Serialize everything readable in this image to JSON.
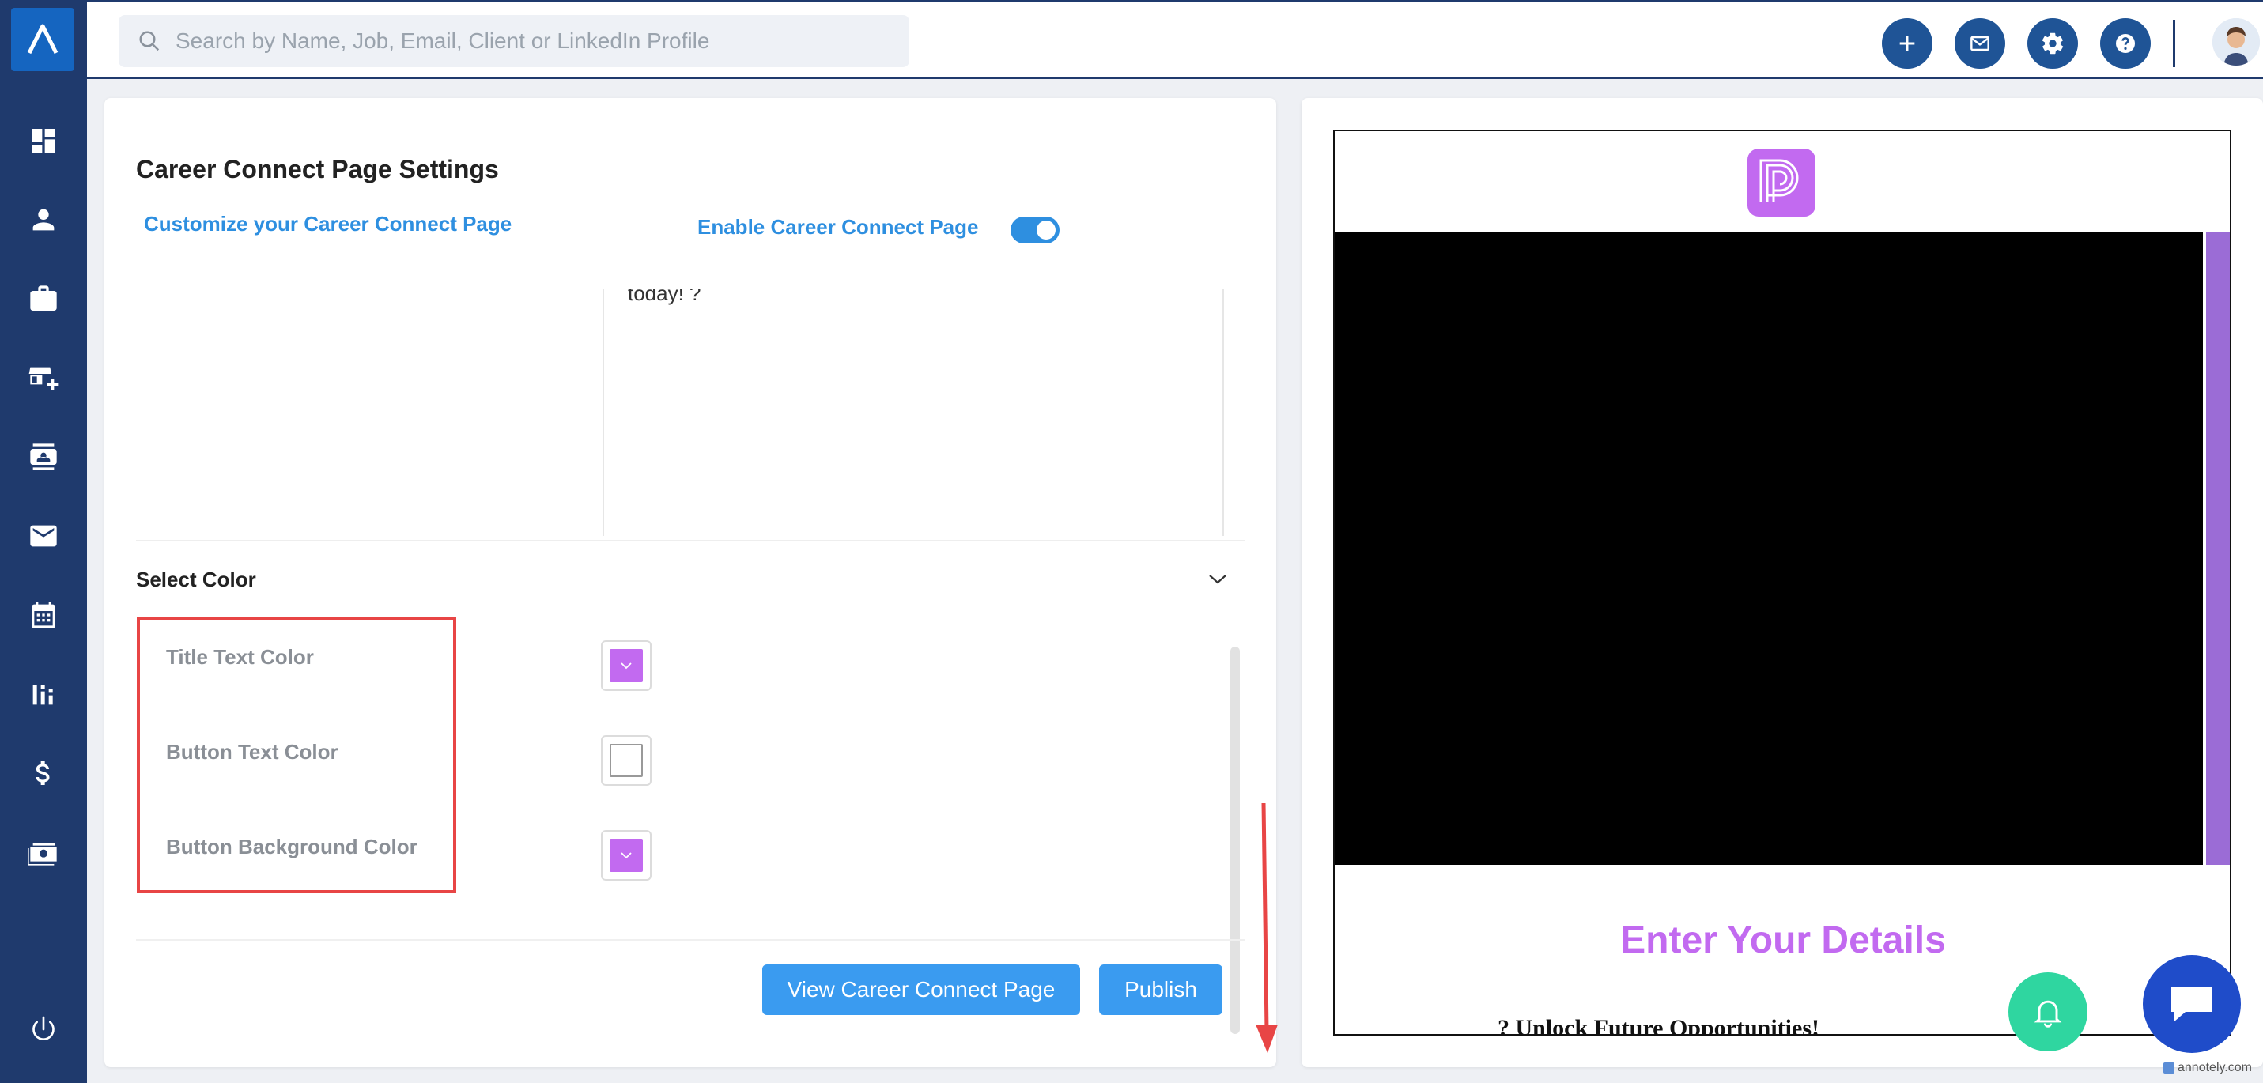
{
  "header": {
    "search_placeholder": "Search by Name, Job, Email, Client or LinkedIn Profile",
    "icons": [
      "plus-icon",
      "mail-icon",
      "gear-icon",
      "help-icon"
    ]
  },
  "sidebar": {
    "items": [
      "dashboard-icon",
      "candidates-icon",
      "jobs-icon",
      "clients-icon",
      "contacts-icon",
      "email-icon",
      "calendar-icon",
      "reports-icon",
      "billing-icon",
      "payments-icon",
      "logout-icon"
    ]
  },
  "settings": {
    "title": "Career Connect Page Settings",
    "customize_link": "Customize your Career Connect Page",
    "enable_label": "Enable Career Connect Page",
    "enabled": true,
    "editor_text": "today! ?",
    "select_color_label": "Select Color",
    "colors": [
      {
        "label": "Title Text Color",
        "value": "#c26af0"
      },
      {
        "label": "Button Text Color",
        "value": "#ffffff"
      },
      {
        "label": "Button Background Color",
        "value": "#c26af0"
      }
    ],
    "view_button": "View Career Connect Page",
    "publish_button": "Publish"
  },
  "preview": {
    "heading": "Enter Your Details",
    "subheading": "? Unlock Future Opportunities!"
  },
  "watermark": "annotely.com"
}
